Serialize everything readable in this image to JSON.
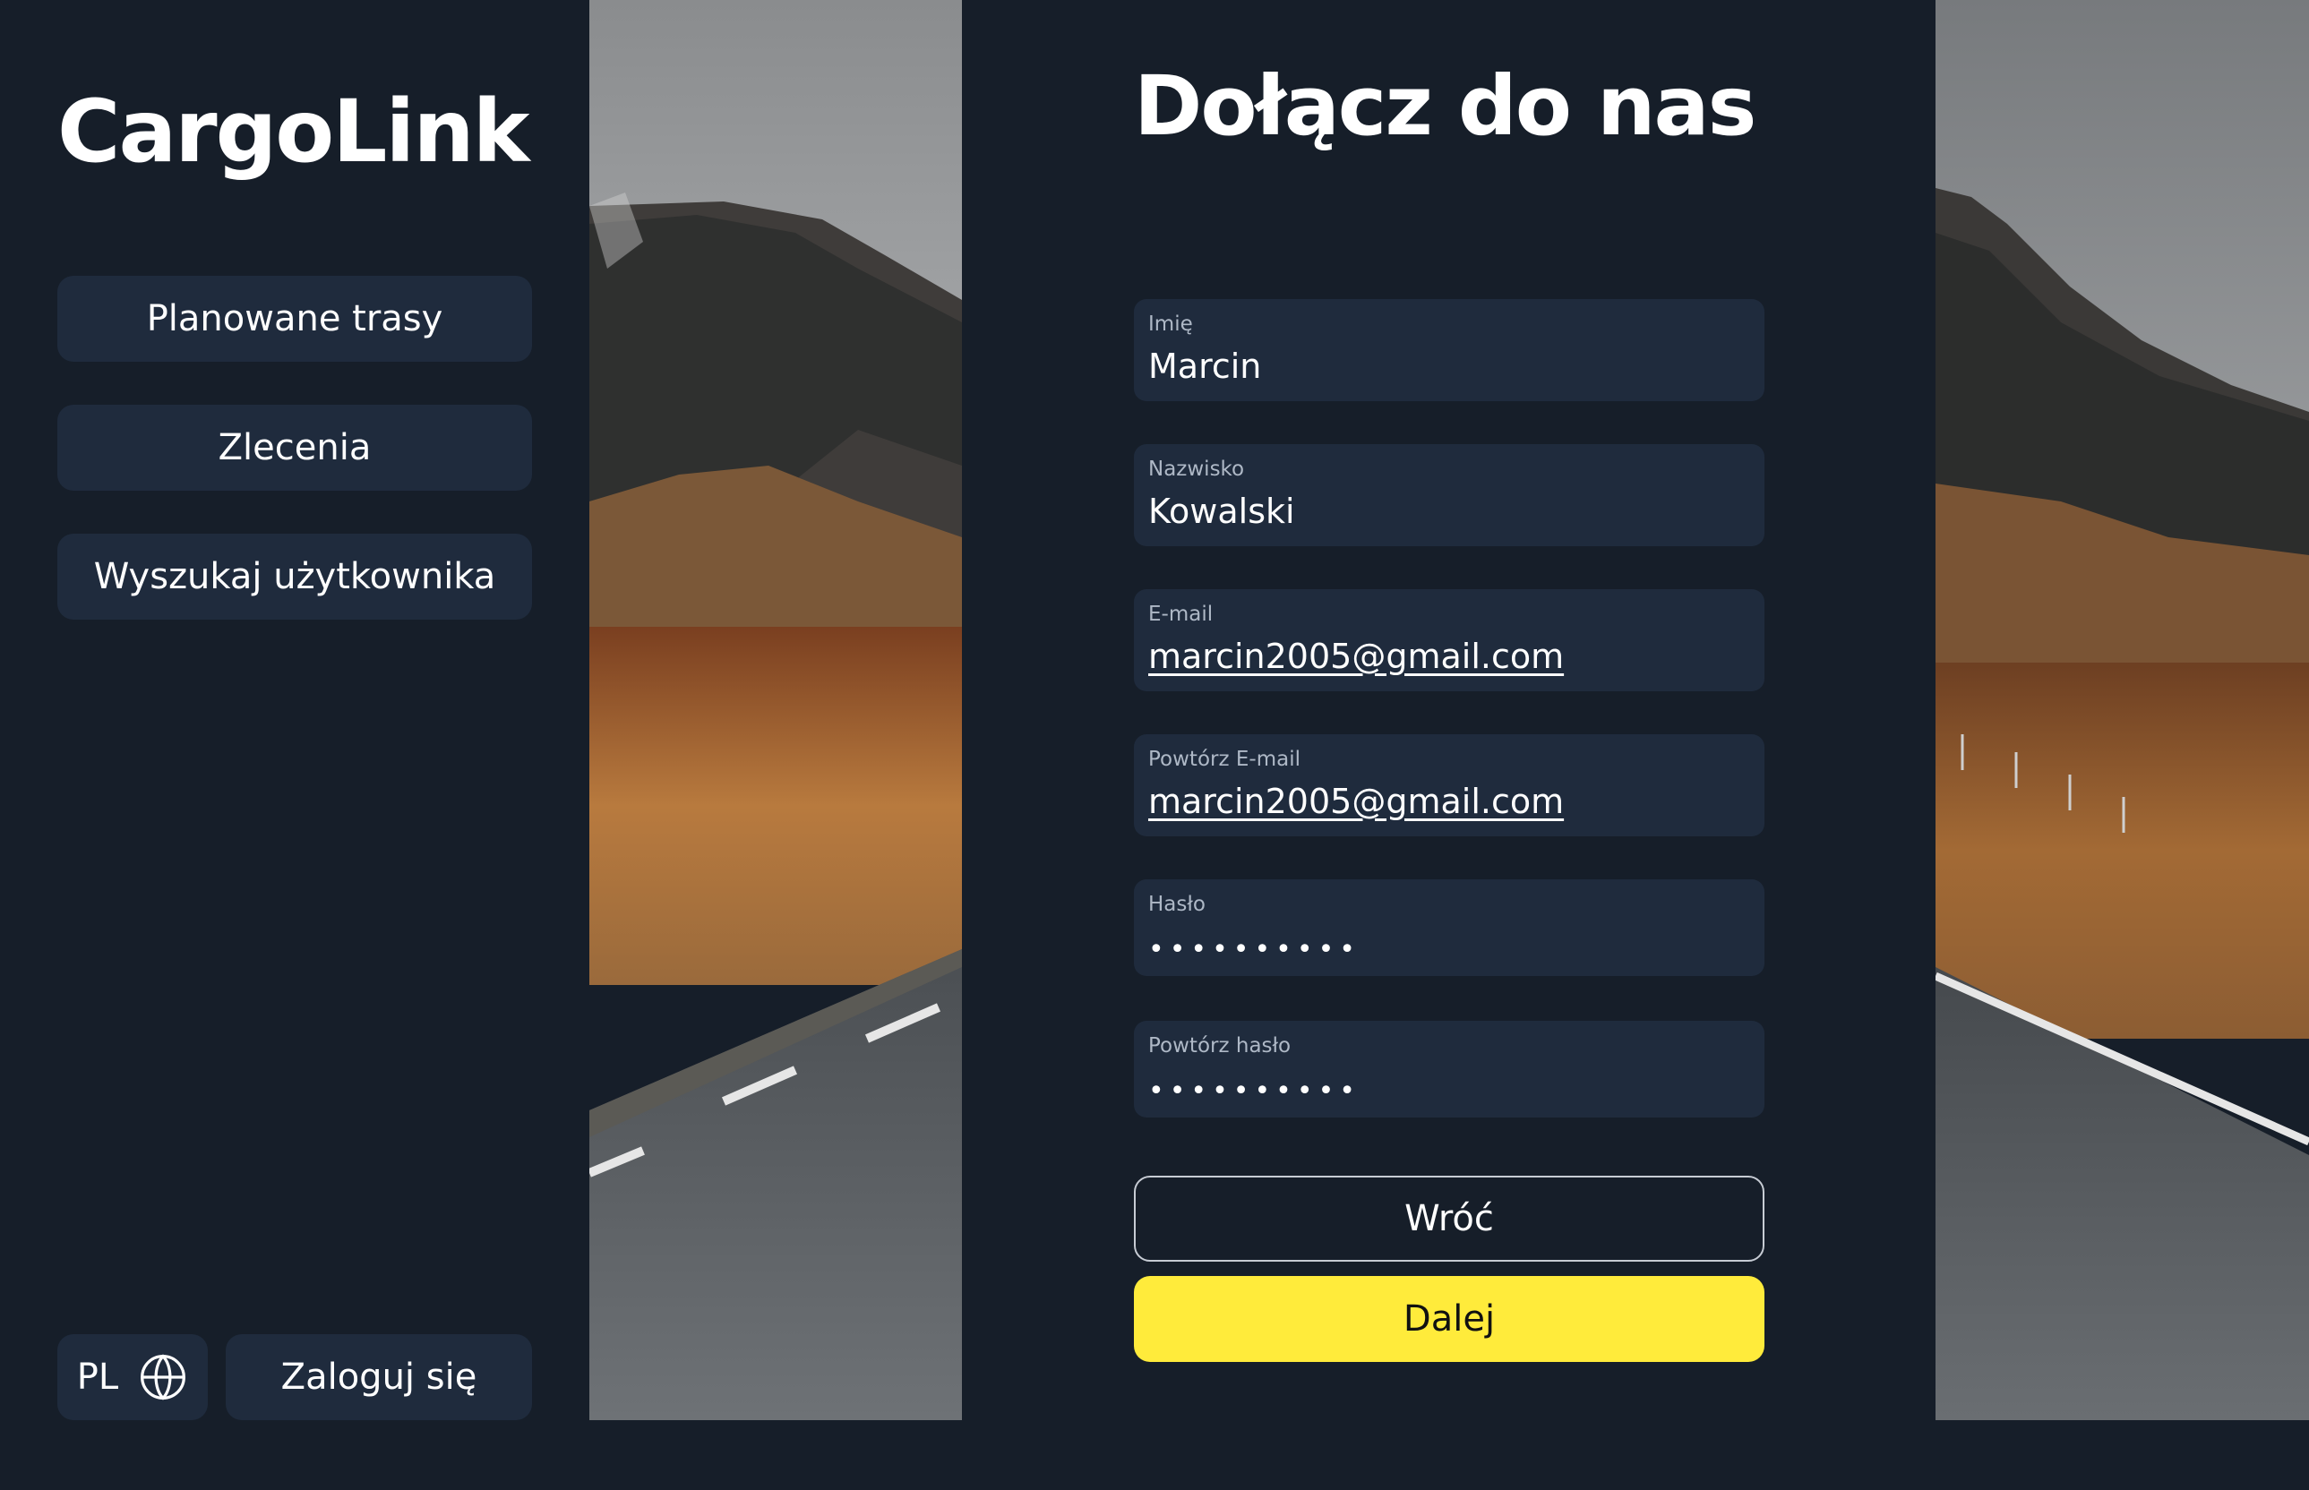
{
  "app": {
    "logo": "CargoLink"
  },
  "sidebar": {
    "items": [
      {
        "label": "Planowane trasy"
      },
      {
        "label": "Zlecenia"
      },
      {
        "label": "Wyszukaj użytkownika"
      }
    ],
    "language": "PL",
    "language_icon": "globe-icon",
    "login_label": "Zaloguj się"
  },
  "form": {
    "title": "Dołącz do nas",
    "fields": [
      {
        "label": "Imię",
        "value": "Marcin"
      },
      {
        "label": "Nazwisko",
        "value": "Kowalski"
      },
      {
        "label": "E-mail",
        "value": "marcin2005@gmail.com"
      },
      {
        "label": "Powtórz E-mail",
        "value": "marcin2005@gmail.com"
      },
      {
        "label": "Hasło",
        "value": "••••••••••"
      },
      {
        "label": "Powtórz hasło",
        "value": "••••••••••"
      }
    ],
    "back_label": "Wróć",
    "next_label": "Dalej"
  },
  "colors": {
    "background": "#161e29",
    "surface": "#1f2b3d",
    "accent": "#ffeb3b"
  }
}
